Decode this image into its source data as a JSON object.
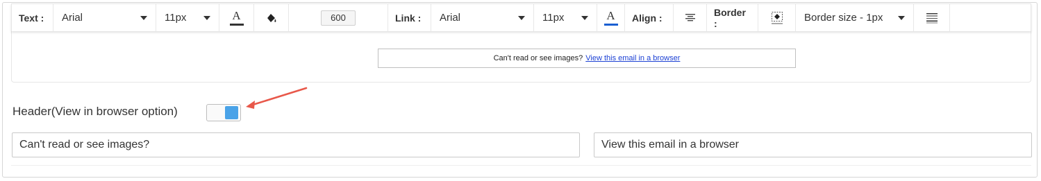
{
  "toolbar": {
    "text_label": "Text :",
    "text_font": "Arial",
    "text_size": "11px",
    "text_weight": "600",
    "link_label": "Link :",
    "link_font": "Arial",
    "link_size": "11px",
    "align_label": "Align :",
    "border_label": "Border :",
    "border_size": "Border size - 1px",
    "text_color_glyph": "A",
    "link_color_glyph": "A",
    "colors": {
      "text_color_bar": "#333333",
      "link_color_bar": "#1a5fd1"
    },
    "icons": [
      "font-color-icon",
      "fill-bucket-icon",
      "font-color-icon",
      "align-center-icon",
      "border-style-icon",
      "border-size-icon",
      "border-lines-icon"
    ]
  },
  "preview": {
    "text": "Can't read or see images?",
    "link": "View this email in a browser"
  },
  "header_option": {
    "label": "Header(View in browser option)",
    "toggle_on": true,
    "toggle_color": "#4aa3e8"
  },
  "fields": {
    "left_value": "Can't read or see images?",
    "right_value": "View this email in a browser"
  },
  "annotation": {
    "arrow_color": "#e8584a"
  }
}
